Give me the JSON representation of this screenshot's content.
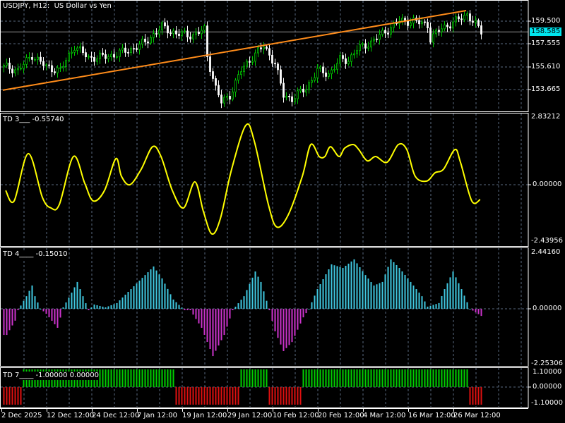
{
  "header": {
    "title": "USDJPY, H12:  US Dollar vs Yen"
  },
  "price_axis": {
    "labels": [
      "159.500",
      "157.555",
      "155.610",
      "153.665"
    ],
    "current_price": "158.585"
  },
  "indicators": {
    "td3": {
      "title": "TD 3___ -0.55740",
      "max": "2.83212",
      "zero": "0.00000",
      "min": "-2.43956"
    },
    "td4": {
      "title": "TD 4____ -0.15010",
      "max": "2.44160",
      "zero": "0.00000",
      "min": "-2.25306"
    },
    "td7": {
      "title": "TD 7____ -1.00000 0.00000",
      "max": "1.10000",
      "zero": "0.00000",
      "min": "-1.10000"
    }
  },
  "time_axis": {
    "labels": [
      "2 Dec 2025",
      "12 Dec 12:00",
      "24 Dec 12:00",
      "7 Jan 12:00",
      "19 Jan 12:00",
      "29 Jan 12:00",
      "10 Feb 12:00",
      "20 Feb 12:00",
      "4 Mar 12:00",
      "16 Mar 12:00",
      "26 Mar 12:00"
    ]
  },
  "colors": {
    "bull": "#00c800",
    "bear": "#ffffff",
    "trendline": "#ff8c1a",
    "td3_line": "#ffff00",
    "td4_pos": "#40c8e0",
    "td4_neg": "#cc33cc",
    "td7_pos": "#00d000",
    "td7_neg": "#e01010",
    "grid": "#5a6a80",
    "price_tag": "#00e5ee"
  },
  "chart_data": {
    "type": "line",
    "price_keypoints": [
      [
        1,
        155.59
      ],
      [
        5,
        155.29
      ],
      [
        10,
        156.61
      ],
      [
        15,
        155.59
      ],
      [
        20,
        155.29
      ],
      [
        25,
        157.39
      ],
      [
        30,
        156.37
      ],
      [
        37,
        156.49
      ],
      [
        45,
        157.09
      ],
      [
        50,
        157.7
      ],
      [
        56,
        159.02
      ],
      [
        61,
        158.42
      ],
      [
        67,
        158.3
      ],
      [
        71,
        158.78
      ],
      [
        72,
        156.49
      ],
      [
        75,
        153.79
      ],
      [
        77,
        152.58
      ],
      [
        80,
        153.18
      ],
      [
        84,
        155.29
      ],
      [
        87,
        156.19
      ],
      [
        92,
        157.39
      ],
      [
        96,
        155.89
      ],
      [
        99,
        153.18
      ],
      [
        102,
        152.88
      ],
      [
        107,
        153.79
      ],
      [
        111,
        155.29
      ],
      [
        115,
        154.99
      ],
      [
        119,
        156.19
      ],
      [
        122,
        156.19
      ],
      [
        125,
        157.09
      ],
      [
        130,
        157.7
      ],
      [
        135,
        158.6
      ],
      [
        140,
        159.5
      ],
      [
        145,
        159.5
      ],
      [
        150,
        159.2
      ],
      [
        151,
        158.0
      ],
      [
        155,
        158.9
      ],
      [
        160,
        159.5
      ],
      [
        164,
        160.1
      ],
      [
        166,
        159.5
      ],
      [
        169,
        158.6
      ]
    ],
    "trendline": [
      [
        0,
        153.61
      ],
      [
        164,
        160.4
      ]
    ],
    "td3": [
      [
        1,
        -0.24
      ],
      [
        4,
        -0.68
      ],
      [
        9,
        1.3
      ],
      [
        14,
        -0.53
      ],
      [
        17,
        -0.97
      ],
      [
        20,
        -0.83
      ],
      [
        25,
        1.18
      ],
      [
        29,
        0.06
      ],
      [
        32,
        -0.68
      ],
      [
        36,
        -0.24
      ],
      [
        40,
        1.09
      ],
      [
        42,
        0.35
      ],
      [
        45,
        0
      ],
      [
        49,
        0.65
      ],
      [
        53,
        1.59
      ],
      [
        56,
        1.18
      ],
      [
        60,
        -0.24
      ],
      [
        64,
        -0.97
      ],
      [
        68,
        0.12
      ],
      [
        71,
        -1.12
      ],
      [
        74,
        -2.06
      ],
      [
        77,
        -1.42
      ],
      [
        81,
        0.65
      ],
      [
        86,
        2.48
      ],
      [
        89,
        1.83
      ],
      [
        94,
        -0.83
      ],
      [
        97,
        -1.77
      ],
      [
        101,
        -1.27
      ],
      [
        106,
        0.35
      ],
      [
        109,
        1.68
      ],
      [
        112,
        1.18
      ],
      [
        114,
        1.18
      ],
      [
        116,
        1.59
      ],
      [
        119,
        1.18
      ],
      [
        121,
        1.53
      ],
      [
        124,
        1.68
      ],
      [
        126,
        1.47
      ],
      [
        129,
        1.0
      ],
      [
        132,
        1.18
      ],
      [
        136,
        0.94
      ],
      [
        140,
        1.68
      ],
      [
        143,
        1.47
      ],
      [
        146,
        0.35
      ],
      [
        150,
        0.15
      ],
      [
        153,
        0.5
      ],
      [
        156,
        0.65
      ],
      [
        160,
        1.47
      ],
      [
        162,
        0.94
      ],
      [
        166,
        -0.68
      ],
      [
        169,
        -0.62
      ]
    ],
    "td4": [
      [
        1,
        -1.1
      ],
      [
        4,
        -0.5
      ],
      [
        5,
        -0.06
      ],
      [
        8,
        0.53
      ],
      [
        10,
        0.98
      ],
      [
        11,
        0.53
      ],
      [
        13,
        0
      ],
      [
        15,
        -0.21
      ],
      [
        19,
        -0.8
      ],
      [
        21,
        0.06
      ],
      [
        24,
        0.68
      ],
      [
        26,
        1.13
      ],
      [
        28,
        0.53
      ],
      [
        30,
        -0.06
      ],
      [
        32,
        0.18
      ],
      [
        36,
        0.06
      ],
      [
        40,
        0.24
      ],
      [
        45,
        0.83
      ],
      [
        50,
        1.42
      ],
      [
        53,
        1.78
      ],
      [
        56,
        1.28
      ],
      [
        60,
        0.39
      ],
      [
        64,
        -0.06
      ],
      [
        66,
        -0.06
      ],
      [
        70,
        -0.8
      ],
      [
        74,
        -1.99
      ],
      [
        78,
        -1.1
      ],
      [
        81,
        -0.06
      ],
      [
        85,
        0.53
      ],
      [
        89,
        1.57
      ],
      [
        91,
        1.13
      ],
      [
        94,
        -0.06
      ],
      [
        96,
        -0.95
      ],
      [
        99,
        -1.78
      ],
      [
        102,
        -1.4
      ],
      [
        106,
        -0.36
      ],
      [
        108,
        0
      ],
      [
        111,
        0.83
      ],
      [
        116,
        1.87
      ],
      [
        120,
        1.72
      ],
      [
        124,
        2.08
      ],
      [
        128,
        1.42
      ],
      [
        131,
        0.98
      ],
      [
        134,
        1.13
      ],
      [
        137,
        2.08
      ],
      [
        140,
        1.72
      ],
      [
        144,
        1.13
      ],
      [
        148,
        0.53
      ],
      [
        150,
        0.09
      ],
      [
        154,
        0.24
      ],
      [
        156,
        0.83
      ],
      [
        159,
        1.57
      ],
      [
        162,
        0.83
      ],
      [
        165,
        0
      ],
      [
        169,
        -0.3
      ]
    ],
    "td7_segments": [
      [
        0,
        6,
        -1
      ],
      [
        7,
        60,
        1
      ],
      [
        61,
        83,
        -1
      ],
      [
        84,
        93,
        1
      ],
      [
        94,
        105,
        -1
      ],
      [
        106,
        164,
        1
      ],
      [
        165,
        169,
        -1
      ]
    ]
  }
}
